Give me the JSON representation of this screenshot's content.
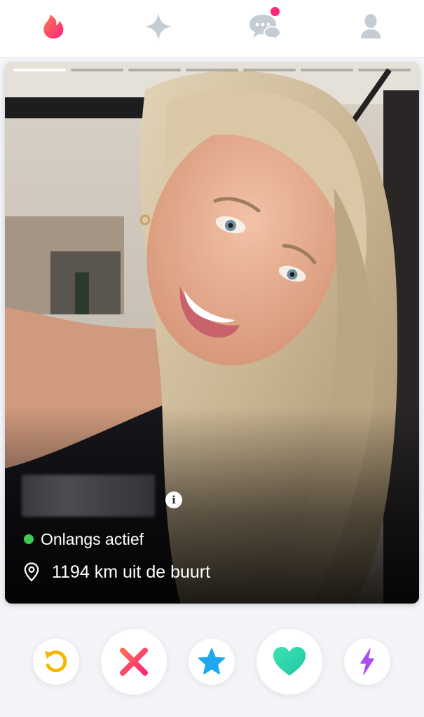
{
  "nav": {
    "items": [
      {
        "name": "swipe",
        "icon": "flame-icon",
        "active": true
      },
      {
        "name": "explore",
        "icon": "sparkle-icon"
      },
      {
        "name": "messages",
        "icon": "chat-bubbles-icon",
        "has_notification": true
      },
      {
        "name": "profile",
        "icon": "person-icon"
      }
    ]
  },
  "card": {
    "photo_count": 7,
    "current_photo": 1,
    "activity_status": "Onlangs actief",
    "distance": "1194 km uit de buurt",
    "info_symbol": "i"
  },
  "actions": [
    {
      "name": "rewind",
      "icon": "rewind-icon",
      "color": "#f5b800"
    },
    {
      "name": "nope",
      "icon": "x-icon",
      "color": "#fd267d"
    },
    {
      "name": "super-like",
      "icon": "star-icon",
      "color": "#1ea8f0"
    },
    {
      "name": "like",
      "icon": "heart-icon",
      "color": "#29d9a9"
    },
    {
      "name": "boost",
      "icon": "lightning-icon",
      "color": "#a84ff0"
    }
  ],
  "colors": {
    "brand": "#fd267d",
    "online": "#3ec954",
    "nav_inactive": "#c6ccd4"
  }
}
